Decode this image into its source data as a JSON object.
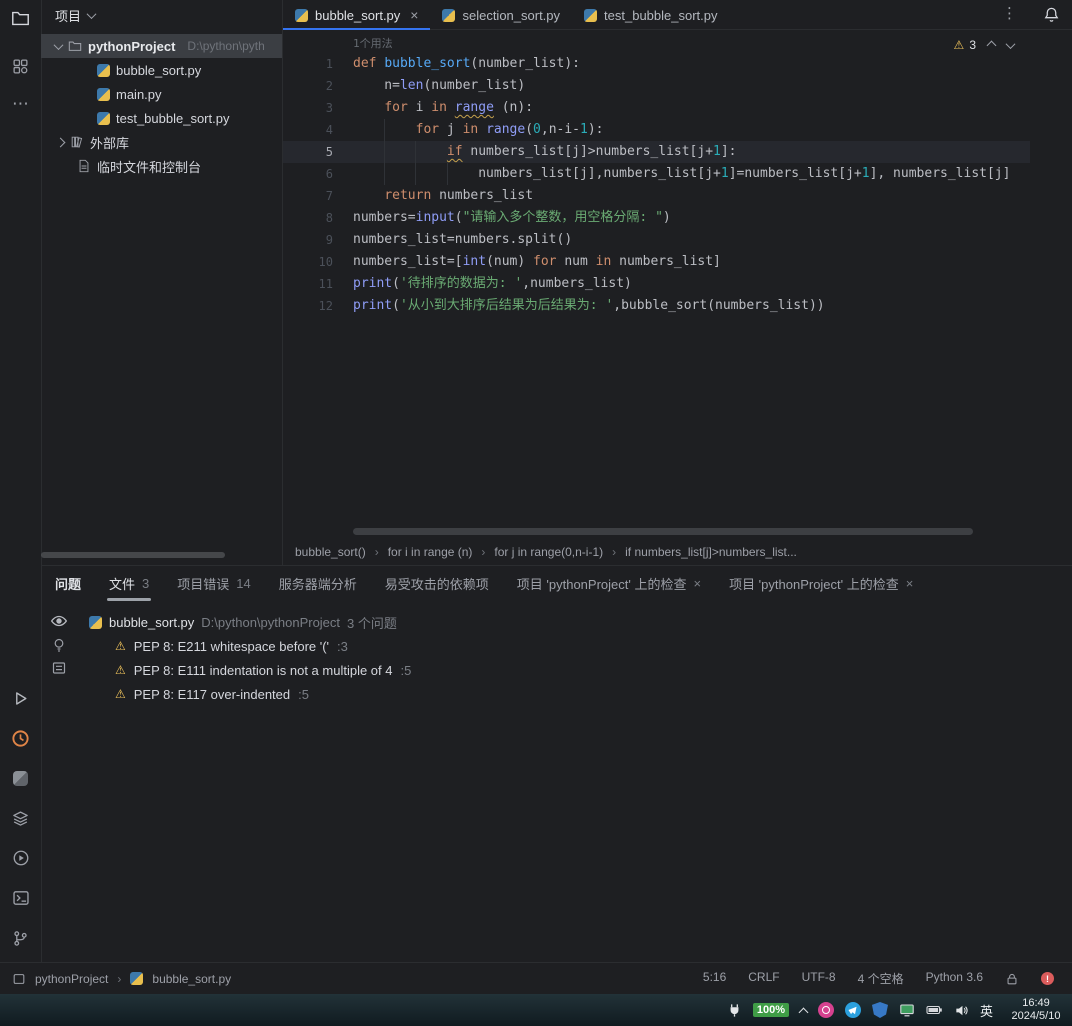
{
  "app": {
    "accent_color": "#3574f0",
    "warning_color": "#f2c55c"
  },
  "left_rail": {
    "top_icons": [
      "project-folder-icon",
      "structure-icon",
      "more-tool-windows-icon"
    ],
    "bottom_icons": [
      "run-icon",
      "profiler-clock-icon",
      "python-console-icon",
      "layers-icon",
      "services-icon",
      "terminal-icon",
      "version-control-icon"
    ]
  },
  "project_panel": {
    "title": "项目",
    "tree": [
      {
        "label": "pythonProject",
        "hint": "D:\\python\\pyth",
        "icon": "folder",
        "chev": "down",
        "selected": true,
        "bold": true,
        "pad": 14
      },
      {
        "label": "bubble_sort.py",
        "icon": "py",
        "pad": 56
      },
      {
        "label": "main.py",
        "icon": "py",
        "pad": 56
      },
      {
        "label": "test_bubble_sort.py",
        "icon": "py",
        "pad": 56
      },
      {
        "label": "外部库",
        "icon": "lib",
        "chev": "right",
        "pad": 16
      },
      {
        "label": "临时文件和控制台",
        "icon": "scratch",
        "pad": 36
      }
    ]
  },
  "editor": {
    "tabs": [
      {
        "label": "bubble_sort.py",
        "active": true,
        "closable": true
      },
      {
        "label": "selection_sort.py"
      },
      {
        "label": "test_bubble_sort.py"
      }
    ],
    "usage_hint": "1个用法",
    "inspection_warnings": "3",
    "current_line": 5,
    "lines": [
      {
        "n": 1,
        "s": [
          [
            "k",
            "def "
          ],
          [
            "f",
            "bubble_sort"
          ],
          [
            "c",
            "(number_list):"
          ]
        ]
      },
      {
        "n": 2,
        "s": [
          [
            "c",
            "    n="
          ],
          [
            "b",
            "len"
          ],
          [
            "c",
            "(number_list)"
          ]
        ]
      },
      {
        "n": 3,
        "s": [
          [
            "c",
            "    "
          ],
          [
            "k",
            "for"
          ],
          [
            "c",
            " i "
          ],
          [
            "k",
            "in"
          ],
          [
            "c",
            " "
          ],
          [
            "b wv",
            "range"
          ],
          [
            "c",
            " (n):"
          ]
        ]
      },
      {
        "n": 4,
        "s": [
          [
            "c",
            "        "
          ],
          [
            "k",
            "for"
          ],
          [
            "c",
            " j "
          ],
          [
            "k",
            "in"
          ],
          [
            "c",
            " "
          ],
          [
            "b",
            "range"
          ],
          [
            "c",
            "("
          ],
          [
            "num",
            "0"
          ],
          [
            "c",
            ",n-i-"
          ],
          [
            "num",
            "1"
          ],
          [
            "c",
            "):"
          ]
        ]
      },
      {
        "n": 5,
        "s": [
          [
            "c",
            "            "
          ],
          [
            "k wv",
            "if"
          ],
          [
            "c",
            " numbers_list[j]>numbers_list[j+"
          ],
          [
            "num",
            "1"
          ],
          [
            "c",
            "]:"
          ]
        ]
      },
      {
        "n": 6,
        "s": [
          [
            "c",
            "                numbers_list[j],numbers_list[j+"
          ],
          [
            "num",
            "1"
          ],
          [
            "c",
            "]=numbers_list[j+"
          ],
          [
            "num",
            "1"
          ],
          [
            "c",
            "], numbers_list[j]"
          ]
        ]
      },
      {
        "n": 7,
        "s": [
          [
            "c",
            "    "
          ],
          [
            "k",
            "return"
          ],
          [
            "c",
            " numbers_list"
          ]
        ]
      },
      {
        "n": 8,
        "s": [
          [
            "c",
            "numbers="
          ],
          [
            "b",
            "input"
          ],
          [
            "c",
            "("
          ],
          [
            "s",
            "\"请输入多个整数，用空格分隔: \""
          ],
          [
            "c",
            ")"
          ]
        ]
      },
      {
        "n": 9,
        "s": [
          [
            "c",
            "numbers_list=numbers.split()"
          ]
        ]
      },
      {
        "n": 10,
        "s": [
          [
            "c",
            "numbers_list=["
          ],
          [
            "b",
            "int"
          ],
          [
            "c",
            "(num) "
          ],
          [
            "k",
            "for"
          ],
          [
            "c",
            " num "
          ],
          [
            "k",
            "in"
          ],
          [
            "c",
            " numbers_list]"
          ]
        ]
      },
      {
        "n": 11,
        "s": [
          [
            "b",
            "print"
          ],
          [
            "c",
            "("
          ],
          [
            "s",
            "'待排序的数据为: '"
          ],
          [
            "c",
            ",numbers_list)"
          ]
        ]
      },
      {
        "n": 12,
        "s": [
          [
            "b",
            "print"
          ],
          [
            "c",
            "("
          ],
          [
            "s",
            "'从小到大排序后结果为后结果为: '"
          ],
          [
            "c",
            ",bubble_sort(numbers_list))"
          ]
        ]
      }
    ],
    "breadcrumbs": [
      "bubble_sort()",
      "for i in range (n)",
      "for j in range(0,n-i-1)",
      "if numbers_list[j]>numbers_list..."
    ]
  },
  "problems": {
    "title": "问题",
    "tabs": [
      {
        "label": "文件",
        "count": "3",
        "active": true
      },
      {
        "label": "项目错误",
        "count": "14"
      },
      {
        "label": "服务器端分析"
      },
      {
        "label": "易受攻击的依赖项"
      },
      {
        "label": "项目 'pythonProject' 上的检查",
        "closable": true
      },
      {
        "label": "项目 'pythonProject' 上的检查",
        "closable": true
      }
    ],
    "file": {
      "name": "bubble_sort.py",
      "path": "D:\\python\\pythonProject",
      "count": "3 个问题"
    },
    "items": [
      {
        "text": "PEP 8: E211 whitespace before '('",
        "loc": ":3"
      },
      {
        "text": "PEP 8: E111 indentation is not a multiple of 4",
        "loc": ":5"
      },
      {
        "text": "PEP 8: E117 over-indented",
        "loc": ":5"
      }
    ]
  },
  "status_bar": {
    "project": "pythonProject",
    "file": "bubble_sort.py",
    "items": [
      "5:16",
      "CRLF",
      "UTF-8",
      "4 个空格",
      "Python 3.6"
    ]
  },
  "taskbar": {
    "battery_percent": "100%",
    "ime": "英",
    "time": "16:49",
    "date": "2024/5/10",
    "tray_icons": [
      "power-plug-icon",
      "battery-percent-badge",
      "tray-expand-chevron",
      "media-app-icon",
      "messenger-app-icon",
      "shield-app-icon",
      "screen-share-icon",
      "battery-icon",
      "speaker-icon",
      "ime-indicator",
      "clock"
    ]
  }
}
